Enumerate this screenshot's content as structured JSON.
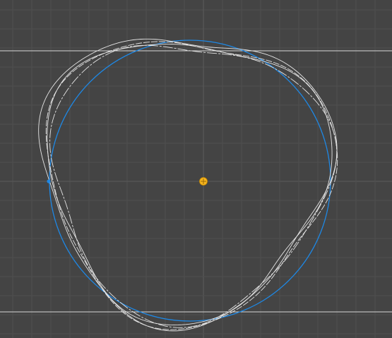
{
  "scene": {
    "background_color": "#444444",
    "grid": {
      "enabled": true,
      "minor_color": "#4f4f4f",
      "major_color": "#5b5b5b"
    },
    "guide_lines": {
      "color": "#d8d8d8",
      "count": 2
    },
    "reference_circle": {
      "color": "#1e88e5",
      "has_handle": true
    },
    "path_strokes": {
      "color": "#e6e6e6",
      "count": 4,
      "shape": "rounded-triangle"
    },
    "center_marker": {
      "color": "#f5b41e",
      "icon": "pivot-point-icon"
    }
  }
}
